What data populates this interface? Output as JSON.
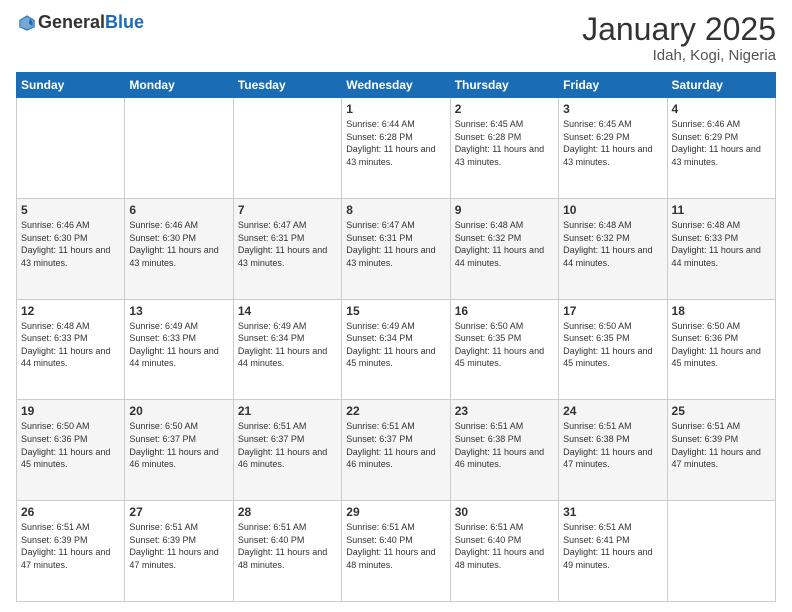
{
  "header": {
    "logo_general": "General",
    "logo_blue": "Blue",
    "month_title": "January 2025",
    "location": "Idah, Kogi, Nigeria"
  },
  "days_of_week": [
    "Sunday",
    "Monday",
    "Tuesday",
    "Wednesday",
    "Thursday",
    "Friday",
    "Saturday"
  ],
  "weeks": [
    [
      {
        "day": "",
        "sunrise": "",
        "sunset": "",
        "daylight": ""
      },
      {
        "day": "",
        "sunrise": "",
        "sunset": "",
        "daylight": ""
      },
      {
        "day": "",
        "sunrise": "",
        "sunset": "",
        "daylight": ""
      },
      {
        "day": "1",
        "sunrise": "Sunrise: 6:44 AM",
        "sunset": "Sunset: 6:28 PM",
        "daylight": "Daylight: 11 hours and 43 minutes."
      },
      {
        "day": "2",
        "sunrise": "Sunrise: 6:45 AM",
        "sunset": "Sunset: 6:28 PM",
        "daylight": "Daylight: 11 hours and 43 minutes."
      },
      {
        "day": "3",
        "sunrise": "Sunrise: 6:45 AM",
        "sunset": "Sunset: 6:29 PM",
        "daylight": "Daylight: 11 hours and 43 minutes."
      },
      {
        "day": "4",
        "sunrise": "Sunrise: 6:46 AM",
        "sunset": "Sunset: 6:29 PM",
        "daylight": "Daylight: 11 hours and 43 minutes."
      }
    ],
    [
      {
        "day": "5",
        "sunrise": "Sunrise: 6:46 AM",
        "sunset": "Sunset: 6:30 PM",
        "daylight": "Daylight: 11 hours and 43 minutes."
      },
      {
        "day": "6",
        "sunrise": "Sunrise: 6:46 AM",
        "sunset": "Sunset: 6:30 PM",
        "daylight": "Daylight: 11 hours and 43 minutes."
      },
      {
        "day": "7",
        "sunrise": "Sunrise: 6:47 AM",
        "sunset": "Sunset: 6:31 PM",
        "daylight": "Daylight: 11 hours and 43 minutes."
      },
      {
        "day": "8",
        "sunrise": "Sunrise: 6:47 AM",
        "sunset": "Sunset: 6:31 PM",
        "daylight": "Daylight: 11 hours and 43 minutes."
      },
      {
        "day": "9",
        "sunrise": "Sunrise: 6:48 AM",
        "sunset": "Sunset: 6:32 PM",
        "daylight": "Daylight: 11 hours and 44 minutes."
      },
      {
        "day": "10",
        "sunrise": "Sunrise: 6:48 AM",
        "sunset": "Sunset: 6:32 PM",
        "daylight": "Daylight: 11 hours and 44 minutes."
      },
      {
        "day": "11",
        "sunrise": "Sunrise: 6:48 AM",
        "sunset": "Sunset: 6:33 PM",
        "daylight": "Daylight: 11 hours and 44 minutes."
      }
    ],
    [
      {
        "day": "12",
        "sunrise": "Sunrise: 6:48 AM",
        "sunset": "Sunset: 6:33 PM",
        "daylight": "Daylight: 11 hours and 44 minutes."
      },
      {
        "day": "13",
        "sunrise": "Sunrise: 6:49 AM",
        "sunset": "Sunset: 6:33 PM",
        "daylight": "Daylight: 11 hours and 44 minutes."
      },
      {
        "day": "14",
        "sunrise": "Sunrise: 6:49 AM",
        "sunset": "Sunset: 6:34 PM",
        "daylight": "Daylight: 11 hours and 44 minutes."
      },
      {
        "day": "15",
        "sunrise": "Sunrise: 6:49 AM",
        "sunset": "Sunset: 6:34 PM",
        "daylight": "Daylight: 11 hours and 45 minutes."
      },
      {
        "day": "16",
        "sunrise": "Sunrise: 6:50 AM",
        "sunset": "Sunset: 6:35 PM",
        "daylight": "Daylight: 11 hours and 45 minutes."
      },
      {
        "day": "17",
        "sunrise": "Sunrise: 6:50 AM",
        "sunset": "Sunset: 6:35 PM",
        "daylight": "Daylight: 11 hours and 45 minutes."
      },
      {
        "day": "18",
        "sunrise": "Sunrise: 6:50 AM",
        "sunset": "Sunset: 6:36 PM",
        "daylight": "Daylight: 11 hours and 45 minutes."
      }
    ],
    [
      {
        "day": "19",
        "sunrise": "Sunrise: 6:50 AM",
        "sunset": "Sunset: 6:36 PM",
        "daylight": "Daylight: 11 hours and 45 minutes."
      },
      {
        "day": "20",
        "sunrise": "Sunrise: 6:50 AM",
        "sunset": "Sunset: 6:37 PM",
        "daylight": "Daylight: 11 hours and 46 minutes."
      },
      {
        "day": "21",
        "sunrise": "Sunrise: 6:51 AM",
        "sunset": "Sunset: 6:37 PM",
        "daylight": "Daylight: 11 hours and 46 minutes."
      },
      {
        "day": "22",
        "sunrise": "Sunrise: 6:51 AM",
        "sunset": "Sunset: 6:37 PM",
        "daylight": "Daylight: 11 hours and 46 minutes."
      },
      {
        "day": "23",
        "sunrise": "Sunrise: 6:51 AM",
        "sunset": "Sunset: 6:38 PM",
        "daylight": "Daylight: 11 hours and 46 minutes."
      },
      {
        "day": "24",
        "sunrise": "Sunrise: 6:51 AM",
        "sunset": "Sunset: 6:38 PM",
        "daylight": "Daylight: 11 hours and 47 minutes."
      },
      {
        "day": "25",
        "sunrise": "Sunrise: 6:51 AM",
        "sunset": "Sunset: 6:39 PM",
        "daylight": "Daylight: 11 hours and 47 minutes."
      }
    ],
    [
      {
        "day": "26",
        "sunrise": "Sunrise: 6:51 AM",
        "sunset": "Sunset: 6:39 PM",
        "daylight": "Daylight: 11 hours and 47 minutes."
      },
      {
        "day": "27",
        "sunrise": "Sunrise: 6:51 AM",
        "sunset": "Sunset: 6:39 PM",
        "daylight": "Daylight: 11 hours and 47 minutes."
      },
      {
        "day": "28",
        "sunrise": "Sunrise: 6:51 AM",
        "sunset": "Sunset: 6:40 PM",
        "daylight": "Daylight: 11 hours and 48 minutes."
      },
      {
        "day": "29",
        "sunrise": "Sunrise: 6:51 AM",
        "sunset": "Sunset: 6:40 PM",
        "daylight": "Daylight: 11 hours and 48 minutes."
      },
      {
        "day": "30",
        "sunrise": "Sunrise: 6:51 AM",
        "sunset": "Sunset: 6:40 PM",
        "daylight": "Daylight: 11 hours and 48 minutes."
      },
      {
        "day": "31",
        "sunrise": "Sunrise: 6:51 AM",
        "sunset": "Sunset: 6:41 PM",
        "daylight": "Daylight: 11 hours and 49 minutes."
      },
      {
        "day": "",
        "sunrise": "",
        "sunset": "",
        "daylight": ""
      }
    ]
  ]
}
